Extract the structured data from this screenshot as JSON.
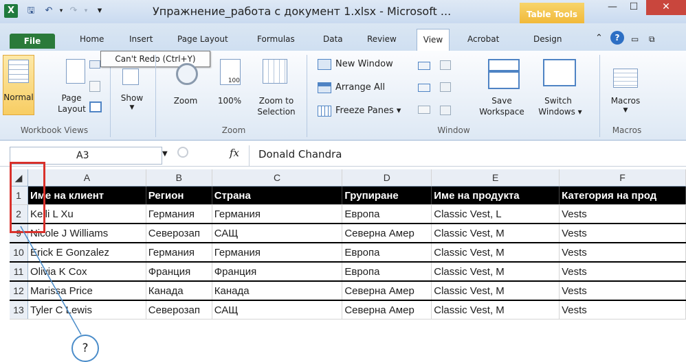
{
  "title_bar": {
    "title": "Упражнение_работа с документ 1.xlsx - Microsoft ...",
    "contextual_tab": "Table Tools",
    "minimize": "—",
    "restore": "☐",
    "close": "✕"
  },
  "tabs": [
    "File",
    "Home",
    "Insert",
    "Page Layout",
    "Formulas",
    "Data",
    "Review",
    "View",
    "Acrobat",
    "Design"
  ],
  "active_tab": "View",
  "tooltip": "Can't Redo (Ctrl+Y)",
  "ribbon": {
    "workbook_views": {
      "label": "Workbook Views",
      "normal": "Normal",
      "page_layout_1": "Page",
      "page_layout_2": "Layout"
    },
    "show": {
      "label": "Show"
    },
    "zoom": {
      "label": "Zoom",
      "zoom": "Zoom",
      "hundred": "100%",
      "zoom_sel_1": "Zoom to",
      "zoom_sel_2": "Selection",
      "hundred_icon": "100"
    },
    "window": {
      "label": "Window",
      "new_window": "New Window",
      "arrange_all": "Arrange All",
      "freeze_panes": "Freeze Panes ▾",
      "save_ws_1": "Save",
      "save_ws_2": "Workspace",
      "switch_1": "Switch",
      "switch_2": "Windows ▾"
    },
    "macros": {
      "label": "Macros",
      "macros": "Macros"
    }
  },
  "formula_bar": {
    "name_box": "A3",
    "fx": "fx",
    "formula": "Donald  Chandra"
  },
  "columns": [
    "A",
    "B",
    "C",
    "D",
    "E",
    "F"
  ],
  "rows": [
    {
      "num": "1",
      "cells": [
        "Име на клиент",
        "Регион",
        "Страна",
        "Групиране",
        "Име на продукта",
        "Категория на прод"
      ]
    },
    {
      "num": "2",
      "cells": [
        "Kelli L Xu",
        "Германия",
        "Германия",
        "Европа",
        "Classic Vest, L",
        "Vests"
      ]
    },
    {
      "num": "9",
      "cells": [
        "Nicole J Williams",
        "Северозап",
        "САЩ",
        "Северна Амер",
        "Classic Vest, M",
        "Vests"
      ]
    },
    {
      "num": "10",
      "cells": [
        "Erick E Gonzalez",
        "Германия",
        "Германия",
        "Европа",
        "Classic Vest, M",
        "Vests"
      ]
    },
    {
      "num": "11",
      "cells": [
        "Olivia K Cox",
        "Франция",
        "Франция",
        "Европа",
        "Classic Vest, M",
        "Vests"
      ]
    },
    {
      "num": "12",
      "cells": [
        "Marissa  Price",
        "Канада",
        "Канада",
        "Северна Амер",
        "Classic Vest, M",
        "Vests"
      ]
    },
    {
      "num": "13",
      "cells": [
        "Tyler C Lewis",
        "Северозап",
        "САЩ",
        "Северна Амер",
        "Classic Vest, M",
        "Vests"
      ]
    }
  ],
  "callout": "?"
}
